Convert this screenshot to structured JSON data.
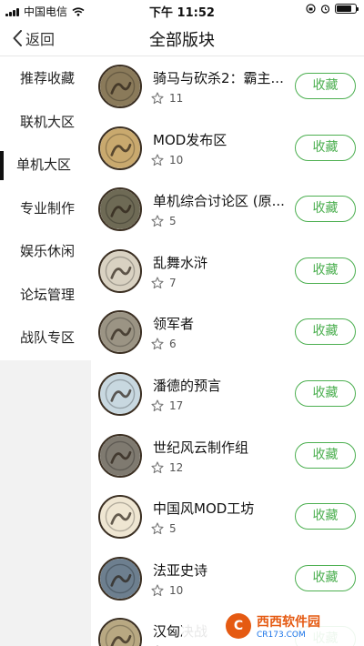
{
  "status_bar": {
    "carrier": "中国电信",
    "time": "下午 11:52"
  },
  "nav": {
    "back_label": "返回",
    "title": "全部版块"
  },
  "sidebar": {
    "active_index": 2,
    "items": [
      {
        "label": "推荐收藏"
      },
      {
        "label": "联机大区"
      },
      {
        "label": "单机大区"
      },
      {
        "label": "专业制作"
      },
      {
        "label": "娱乐休闲"
      },
      {
        "label": "论坛管理"
      },
      {
        "label": "战队专区"
      }
    ]
  },
  "boards": {
    "follow_label": "收藏",
    "items": [
      {
        "title": "骑马与砍杀2：霸主...",
        "count": "11",
        "icon": "horseman-emblem-icon"
      },
      {
        "title": "MOD发布区",
        "count": "10",
        "icon": "red-horse-emblem-icon"
      },
      {
        "title": "单机综合讨论区 (原...",
        "count": "5",
        "icon": "battle-scene-emblem-icon"
      },
      {
        "title": "乱舞水浒",
        "count": "7",
        "icon": "ink-painting-emblem-icon"
      },
      {
        "title": "领军者",
        "count": "6",
        "icon": "commander-emblem-icon"
      },
      {
        "title": "潘德的预言",
        "count": "17",
        "icon": "prophesy-emblem-icon"
      },
      {
        "title": "世纪风云制作组",
        "count": "12",
        "icon": "group-emblem-icon"
      },
      {
        "title": "中国风MOD工坊",
        "count": "5",
        "icon": "seal-script-emblem-icon"
      },
      {
        "title": "法亚史诗",
        "count": "10",
        "icon": "epic-emblem-icon"
      },
      {
        "title": "汉匈决战",
        "count": "",
        "icon": "han-xiongnu-emblem-icon"
      }
    ]
  },
  "watermark": {
    "logo_text": "西西软件园",
    "sub_text": "CR173.COM"
  },
  "colors": {
    "accent": "#4caf50",
    "sidebar_bg": "#f2f2f2",
    "avatar_border": "#3b2f22"
  }
}
